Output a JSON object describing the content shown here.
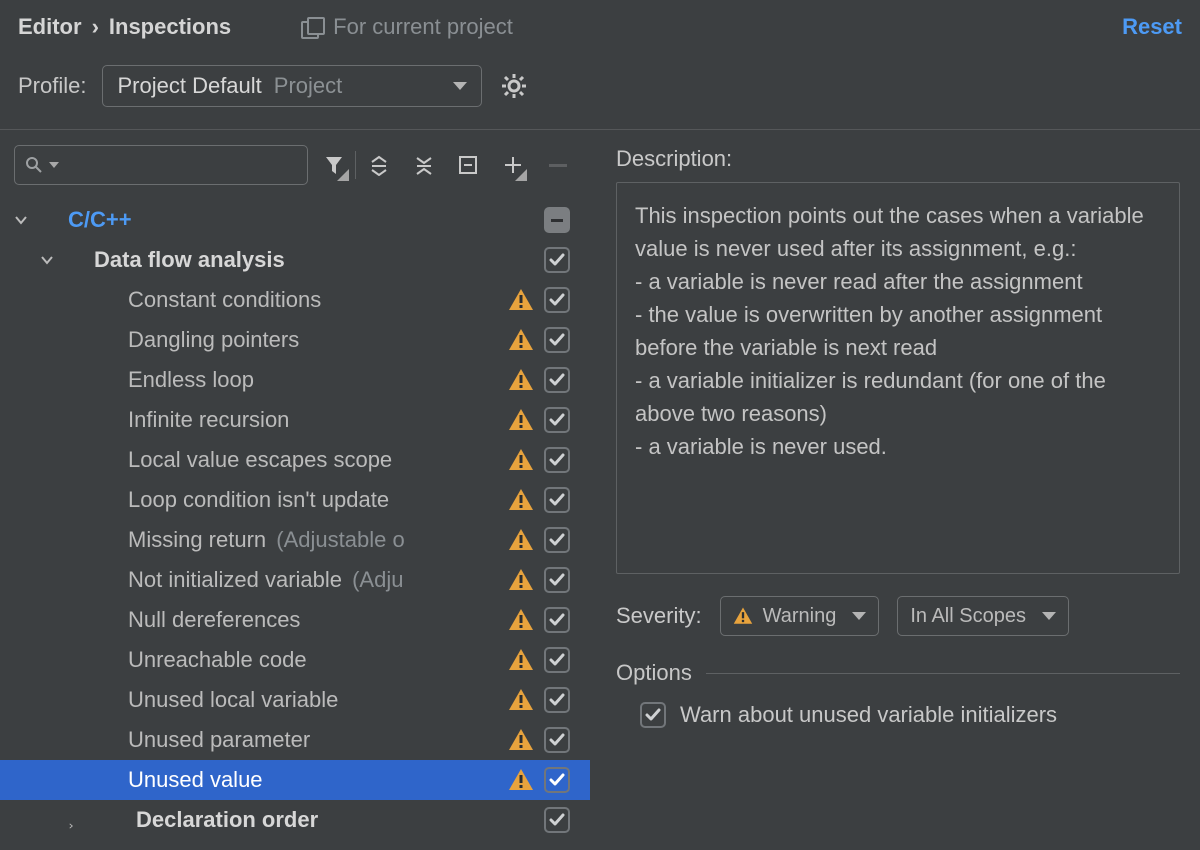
{
  "breadcrumb": {
    "editor": "Editor",
    "sep": "›",
    "inspections": "Inspections"
  },
  "scope_text": "For current project",
  "reset": "Reset",
  "profile": {
    "label": "Profile:",
    "name": "Project Default",
    "badge": "Project"
  },
  "tree": {
    "category": "C/C++",
    "group": "Data flow analysis",
    "items": [
      {
        "label": "Constant conditions"
      },
      {
        "label": "Dangling pointers"
      },
      {
        "label": "Endless loop"
      },
      {
        "label": "Infinite recursion"
      },
      {
        "label": "Local value escapes scope"
      },
      {
        "label": "Loop condition isn't updated",
        "truncated": "Loop condition isn't update"
      },
      {
        "label": "Missing return",
        "hint": "(Adjustable o",
        "hint_full": "(Adjustable …)"
      },
      {
        "label": "Not initialized variable",
        "hint": "(Adju"
      },
      {
        "label": "Null dereferences"
      },
      {
        "label": "Unreachable code"
      },
      {
        "label": "Unused local variable"
      },
      {
        "label": "Unused parameter"
      },
      {
        "label": "Unused value",
        "selected": true
      }
    ],
    "sibling_group": "Declaration order"
  },
  "description_label": "Description:",
  "description": "This inspection points out the cases when a variable value is never used after its assignment, e.g.:\n - a variable is never read after the assignment\n - the value is overwritten by another assignment before the variable is next read\n - a variable initializer is redundant (for one of the above two reasons)\n - a variable is never used.",
  "severity": {
    "label": "Severity:",
    "value": "Warning",
    "scope": "In All Scopes"
  },
  "options": {
    "header": "Options",
    "warn_unused_init": "Warn about unused variable initializers"
  }
}
